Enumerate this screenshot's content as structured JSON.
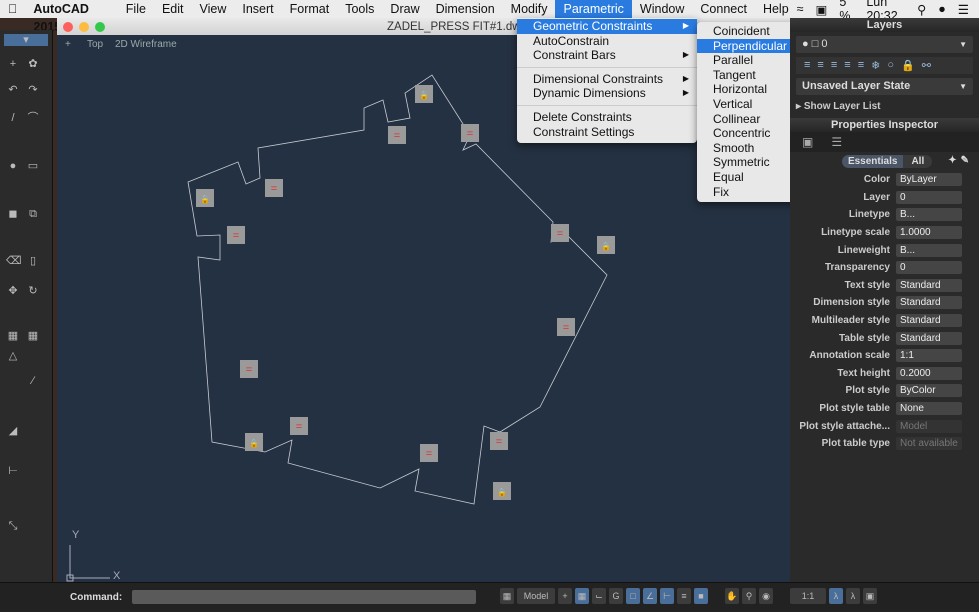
{
  "menubar": {
    "app": "AutoCAD 2015",
    "items": [
      "File",
      "Edit",
      "View",
      "Insert",
      "Format",
      "Tools",
      "Draw",
      "Dimension",
      "Modify",
      "Parametric",
      "Window",
      "Connect",
      "Help"
    ],
    "active": "Parametric",
    "battery": "5 %",
    "clock": "Lun 20:32"
  },
  "window": {
    "title": "ZADEL_PRESS FIT#1.dwg",
    "view_plus": "+",
    "view": "Top",
    "visual_style": "2D Wireframe"
  },
  "parametric_menu": {
    "items": [
      "Geometric Constraints",
      "AutoConstrain",
      "Constraint Bars",
      "Dimensional Constraints",
      "Dynamic Dimensions",
      "Delete Constraints",
      "Constraint Settings"
    ]
  },
  "geometric_submenu": {
    "items": [
      "Coincident",
      "Perpendicular",
      "Parallel",
      "Tangent",
      "Horizontal",
      "Vertical",
      "Collinear",
      "Concentric",
      "Smooth",
      "Symmetric",
      "Equal",
      "Fix"
    ],
    "highlighted": "Perpendicular"
  },
  "layers": {
    "title": "Layers",
    "current_layer": "0",
    "layer_state": "Unsaved Layer State",
    "show_list": "Show Layer List"
  },
  "properties": {
    "title": "Properties Inspector",
    "tabs": [
      "Essentials",
      "All"
    ],
    "rows": [
      {
        "label": "Color",
        "value": "ByLayer"
      },
      {
        "label": "Layer",
        "value": "0"
      },
      {
        "label": "Linetype",
        "value": "B..."
      },
      {
        "label": "Linetype scale",
        "value": "1.0000"
      },
      {
        "label": "Lineweight",
        "value": "B..."
      },
      {
        "label": "Transparency",
        "value": "0"
      },
      {
        "label": "Text style",
        "value": "Standard"
      },
      {
        "label": "Dimension style",
        "value": "Standard"
      },
      {
        "label": "Multileader style",
        "value": "Standard"
      },
      {
        "label": "Table style",
        "value": "Standard"
      },
      {
        "label": "Annotation scale",
        "value": "1:1"
      },
      {
        "label": "Text height",
        "value": "0.2000"
      },
      {
        "label": "Plot style",
        "value": "ByColor"
      },
      {
        "label": "Plot style table",
        "value": "None"
      },
      {
        "label": "Plot style attache...",
        "value": "Model"
      },
      {
        "label": "Plot table type",
        "value": "Not available"
      }
    ]
  },
  "ucs": {
    "y": "Y",
    "x": "X"
  },
  "command": {
    "label": "Command:",
    "value": ""
  },
  "status": {
    "model": "Model",
    "scale": "1:1"
  },
  "colors": {
    "canvas": "#243142",
    "highlight": "#2a7be0",
    "constraint_mark": "#e03030"
  }
}
